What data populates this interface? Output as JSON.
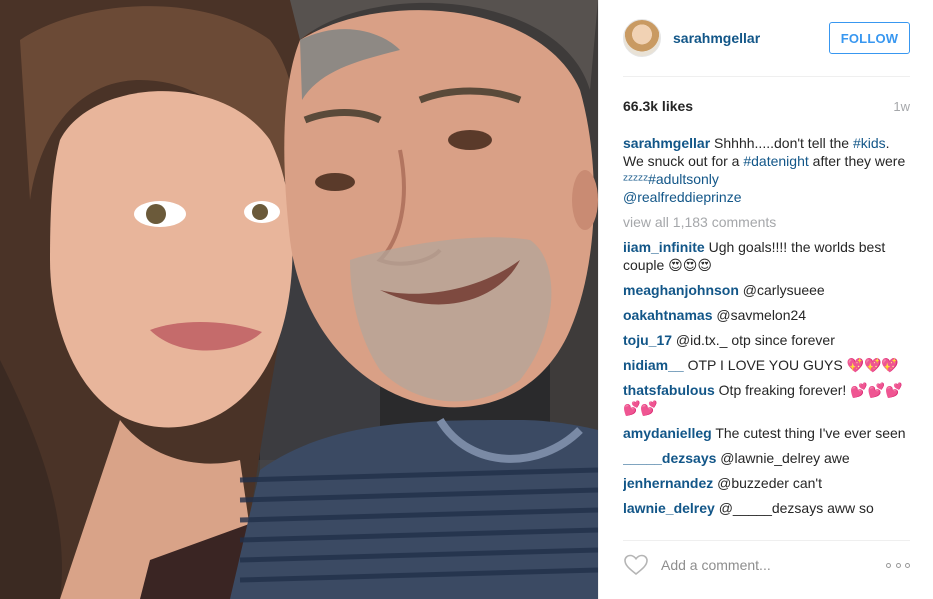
{
  "post": {
    "username": "sarahmgellar",
    "follow_label": "FOLLOW",
    "likes": "66.3k likes",
    "age": "1w"
  },
  "caption": {
    "user": "sarahmgellar",
    "part1": " Shhhh.....don't tell the ",
    "tag1": "#kids",
    "part2": ". We snuck out for a ",
    "tag2": "#datenight",
    "part3": " after they were ",
    "zzz": "ᶻᶻᶻᶻᶻ",
    "tag3": "#adultsonly",
    "mention": "@realfreddieprinze"
  },
  "view_all": "view all 1,183 comments",
  "comments": [
    {
      "user": "iiam_infinite",
      "text": " Ugh goals!!!! the worlds best couple 😍😍😍"
    },
    {
      "user": "meaghanjohnson",
      "text": " @carlysueee"
    },
    {
      "user": "oakahtnamas",
      "text": " @savmelon24"
    },
    {
      "user": "toju_17",
      "text": " @id.tx._ otp since forever"
    },
    {
      "user": "nidiam__",
      "text": " OTP I LOVE YOU GUYS 💖💖💖"
    },
    {
      "user": "thatsfabulous",
      "text": " Otp freaking forever! 💕💕💕💕💕"
    },
    {
      "user": "amydanielleg",
      "text": " The cutest thing I've ever seen"
    },
    {
      "user": "_____dezsays",
      "text": " @lawnie_delrey awe"
    },
    {
      "user": "jenhernandez",
      "text": " @buzzeder can't"
    },
    {
      "user": "lawnie_delrey",
      "text": " @_____dezsays aww so"
    }
  ],
  "footer": {
    "add_comment_placeholder": "Add a comment..."
  },
  "colors": {
    "link_blue": "#125688",
    "follow_blue": "#3897f0",
    "muted_gray": "#a5a7aa"
  },
  "icons": [
    "heart-icon",
    "more-options-icon"
  ]
}
